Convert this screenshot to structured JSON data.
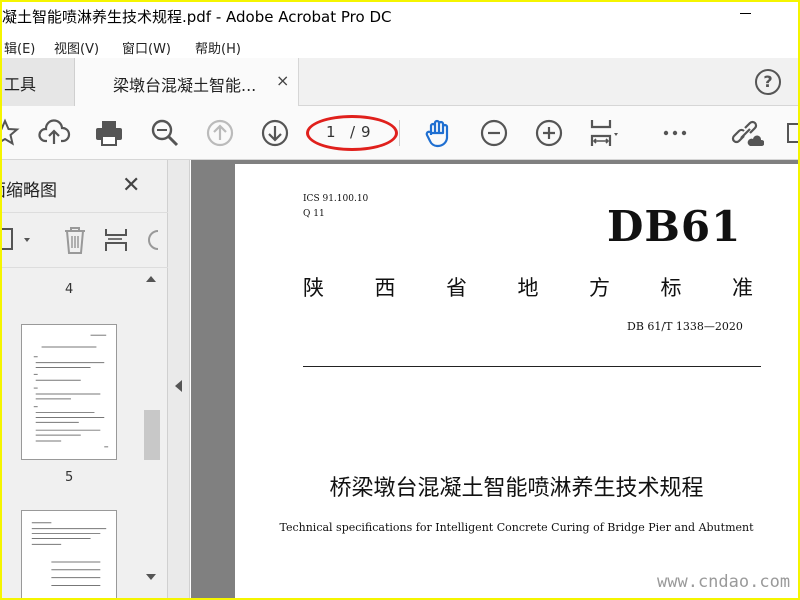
{
  "window": {
    "title": "凝土智能喷淋养生技术规程.pdf - Adobe Acrobat Pro DC"
  },
  "menu": [
    "辑(E)",
    "视图(V)",
    "窗口(W)",
    "帮助(H)"
  ],
  "tabs": {
    "tools_label": "工具",
    "doc_label": "梁墩台混凝土智能...",
    "close": "×",
    "help": "?"
  },
  "toolbar": {
    "current_page": "1",
    "page_sep": "/",
    "total_pages": "9",
    "icons": [
      "star-icon",
      "upload-cloud-icon",
      "print-icon",
      "zoom-search-icon",
      "page-up-icon",
      "page-down-icon",
      "hand-tool-icon",
      "zoom-out-icon",
      "zoom-in-icon",
      "fit-page-icon",
      "more-icon",
      "link-cloud-icon"
    ]
  },
  "sidebar": {
    "title": "页面缩略图",
    "close": "✕",
    "thumbnails": [
      {
        "page": "4"
      },
      {
        "page": "5"
      }
    ]
  },
  "document": {
    "ics": "ICS 91.100.10",
    "q": "Q 11",
    "db": "DB61",
    "standard_chars": [
      "陕",
      "西",
      "省",
      "地",
      "方",
      "标",
      "准"
    ],
    "code": "DB 61/T 1338—2020",
    "title_cn": "桥梁墩台混凝土智能喷淋养生技术规程",
    "title_en": "Technical specifications for Intelligent Concrete Curing of Bridge Pier and Abutment"
  },
  "watermark": {
    "bottom_right": "www.cndao.com"
  }
}
